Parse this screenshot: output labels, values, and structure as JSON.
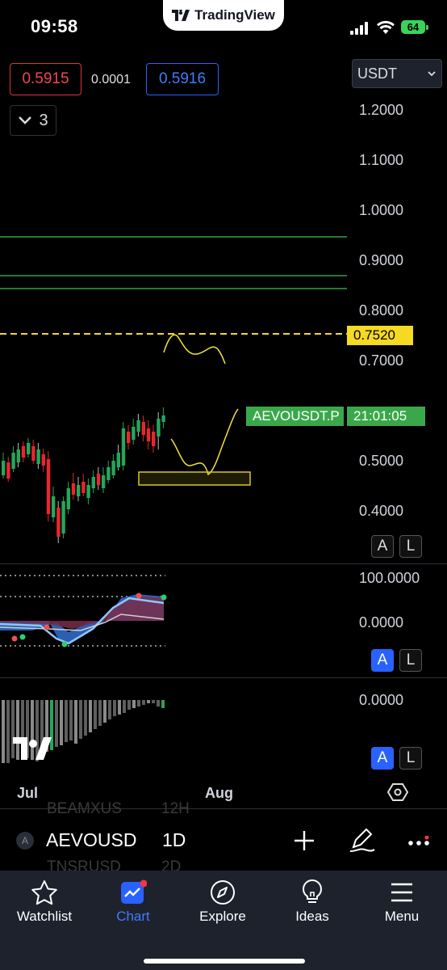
{
  "status_bar": {
    "time": "09:58",
    "battery": "64"
  },
  "brand": {
    "name": "TradingView"
  },
  "quote": {
    "bid": "0.5915",
    "spread": "0.0001",
    "ask": "0.5916",
    "collapse_count": "3"
  },
  "currency": {
    "selected": "USDT"
  },
  "price_axis": {
    "ticks": [
      "1.2000",
      "1.1000",
      "1.0000",
      "0.9000",
      "0.8000",
      "0.7000",
      "0.5000",
      "0.4000"
    ],
    "marked_level": "0.7520",
    "last_symbol_tag": "AEVOUSDT.P",
    "countdown": "21:01:05"
  },
  "oscillator_axis": {
    "ticks": [
      "100.0000",
      "0.0000"
    ]
  },
  "histogram_axis": {
    "ticks": [
      "0.0000"
    ]
  },
  "pane_buttons": {
    "auto": "A",
    "log": "L"
  },
  "time_axis": {
    "labels": [
      "Jul",
      "Aug"
    ]
  },
  "symbol_bar": {
    "symbol": "AEVOUSD",
    "interval": "1D",
    "prev_symbol": "BEAMXUS",
    "prev_interval": "12H",
    "next_symbol": "TNSRUSD",
    "next_interval": "2D",
    "avatar_letter": "A"
  },
  "nav": [
    {
      "label": "Watchlist",
      "icon": "star-icon"
    },
    {
      "label": "Chart",
      "icon": "chart-icon"
    },
    {
      "label": "Explore",
      "icon": "compass-icon"
    },
    {
      "label": "Ideas",
      "icon": "lightbulb-icon"
    },
    {
      "label": "Menu",
      "icon": "hamburger-icon"
    }
  ],
  "colors": {
    "accent": "#2962ff",
    "up": "#26a65b",
    "down": "#e8262e",
    "marked_level": "#f5d922",
    "tag_green": "#3aa84a"
  }
}
